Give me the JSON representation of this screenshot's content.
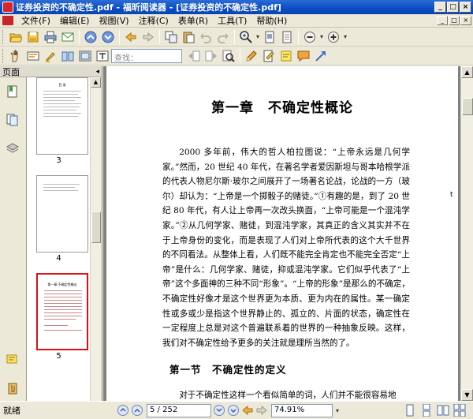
{
  "window": {
    "title": "证券投资的不确定性.pdf - 福昕阅读器 - [证券投资的不确定性.pdf]",
    "controls": [
      "_",
      "□",
      "×"
    ]
  },
  "menu": {
    "items": [
      "文件(F)",
      "编辑(E)",
      "视图(V)",
      "注释(C)",
      "表单(R)",
      "工具(T)",
      "帮助(H)"
    ],
    "mdi_controls": [
      "_",
      "□",
      "×"
    ]
  },
  "toolbar": {
    "find_placeholder": "查找："
  },
  "left_panel": {
    "title": "页面",
    "collapse": "◂",
    "thumbnails": [
      {
        "page": "3",
        "heading": "目  录"
      },
      {
        "page": "4",
        "heading": ""
      },
      {
        "page": "5",
        "heading": "第一章  不确定性概论"
      }
    ]
  },
  "document": {
    "chapter_title": "第一章　不确定性概论",
    "paragraph": "2000 多年前，伟大的哲人柏拉图说：“上帝永远是几何学家。”然而，20 世纪 40 年代，在著名学者爱因斯坦与哥本哈根学派的代表人物尼尔斯·玻尔之间展开了一场著名论战，论战的一方（玻尔）却认为：“上帝是一个掷骰子的赌徒。”①有趣的是，到了 20 世纪 80 年代，有人让上帝再一次改头换面，“上帝可能是一个混沌学家。”②从几何学家、赌徒，到混沌学家，其真正的含义其实并不在于上帝身份的变化，而是表现了人们对上帝所代表的这个大千世界的不同看法。从整体上看，人们既不能完全肯定也不能完全否定“上帝”是什么：几何学家、赌徒，抑或混沌学家。它们似乎代表了“上帝”这个多面神的三种不同“形象”。“上帝的形象”是那么的不确定，不确定性好像才是这个世界更为本质、更为内在的属性。某一确定性或多或少是指这个世界静止的、孤立的、片面的状态，确定性在一定程度上总是对这个普遍联系着的世界的一种抽象反映。这样，我们对不确定性给予更多的关注就是理所当然的了。",
    "margin_mark": "t",
    "section_title": "第一节　不确定性的定义",
    "paragraph2": "对于不确定性这样一个看似简单的词，人们并不能很容易地"
  },
  "status": {
    "text": "就绪",
    "page_field": "5 / 252",
    "zoom_field": "74.91%"
  },
  "colors": {
    "titlebar": "#0a4cc4",
    "chrome": "#ece9d8",
    "workspace": "#808080",
    "selected_thumb_border": "#dd1111"
  }
}
